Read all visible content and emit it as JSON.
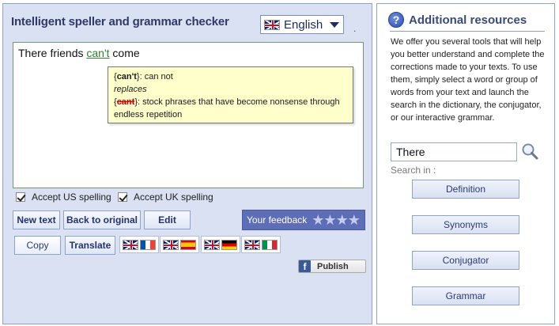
{
  "app": {
    "title": "Intelligent speller and grammar checker",
    "language": {
      "selected": "English",
      "icon": "uk-flag-icon"
    },
    "trailing_dot": "."
  },
  "editor": {
    "text_before": "There friends ",
    "flagged_word": "can't",
    "text_after": " come"
  },
  "tooltip": {
    "open_brace": "{",
    "suggestion": "can't",
    "close_suggestion": "}: can not",
    "replaces_label": "replaces",
    "struck_word": "cant",
    "explanation": "}: stock phrases that have become nonsense through endless repetition"
  },
  "options": {
    "us_spelling": "Accept US spelling",
    "uk_spelling": "Accept UK spelling"
  },
  "toolbar": {
    "new_text": "New text",
    "back_to_original": "Back to original",
    "edit": "Edit",
    "copy": "Copy",
    "translate": "Translate"
  },
  "feedback": {
    "label": "Your feedback",
    "stars": "★★★★",
    "rating": 4
  },
  "translation_pairs": [
    {
      "from": "uk-flag-icon",
      "to": "fr-flag-icon"
    },
    {
      "from": "uk-flag-icon",
      "to": "es-flag-icon"
    },
    {
      "from": "uk-flag-icon",
      "to": "de-flag-icon"
    },
    {
      "from": "uk-flag-icon",
      "to": "it-flag-icon"
    }
  ],
  "publish": {
    "label": "Publish",
    "icon_letter": "f",
    "icon": "facebook-icon"
  },
  "resources": {
    "title": "Additional resources",
    "help_glyph": "?",
    "description": "We offer you several tools that will help you better understand and complete the corrections made to your texts. To use them, simply select a word or group of words from your text and launch the search in the dictionary, the conjugator, or our interactive grammar.",
    "search_value": "There",
    "search_in_label": "Search in :",
    "buttons": [
      "Definition",
      "Synonyms",
      "Conjugator",
      "Grammar"
    ]
  },
  "colors": {
    "panel_bg": "#d9e1f2",
    "title": "#2f3a66",
    "flagged": "#2f7d2f",
    "tooltip_bg": "#ffffcc",
    "feedback_bg": "#5d6eb7"
  }
}
